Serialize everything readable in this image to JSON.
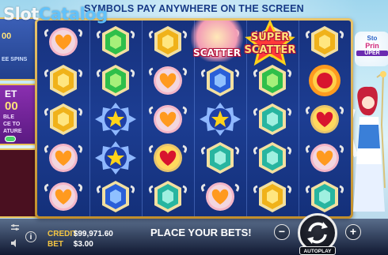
{
  "watermark": {
    "part1": "Slot",
    "part2": "Catalog"
  },
  "banner": {
    "text": "SYMBOLS PAY ANYWHERE ON THE SCREEN"
  },
  "left_panel": {
    "ante_amount": "00",
    "ante_sub": "EE SPINS",
    "bet_title": "ET",
    "bet_amount": "00",
    "bet_desc": "BLE\nCE TO\nATURE"
  },
  "right_panel": {
    "logo_line1": "Sto",
    "logo_line2": "Prin",
    "logo_line3": "UPER"
  },
  "grid": {
    "columns": 6,
    "rows": 5,
    "symbols": [
      [
        "heart-pink",
        "gem-green",
        "gem-yellow",
        "heart-pink",
        "gem-yellow",
        "gem-yellow"
      ],
      [
        "gem-yellow",
        "gem-green",
        "heart-pink",
        "gem-blue",
        "gem-green",
        "sun-red"
      ],
      [
        "gem-yellow",
        "star-blue",
        "heart-pink",
        "star-blue",
        "gem-teal",
        "heart-red"
      ],
      [
        "heart-pink",
        "star-blue",
        "heart-red",
        "gem-teal",
        "gem-teal",
        "heart-pink"
      ],
      [
        "heart-pink",
        "gem-blue",
        "gem-teal",
        "heart-pink",
        "gem-yellow",
        "gem-teal"
      ]
    ],
    "scatter_label": "SCATTER",
    "super_scatter_label_1": "SUPER",
    "super_scatter_label_2": "SCATTER"
  },
  "bottom": {
    "credit_label": "CREDIT",
    "credit_value": "$99,971.60",
    "bet_label": "BET",
    "bet_value": "$3.00",
    "message": "PLACE YOUR BETS!",
    "minus": "−",
    "plus": "+",
    "autoplay": "AUTOPLAY",
    "info": "i"
  },
  "colors": {
    "frame_gold": "#e8c46b",
    "reel_bg": "#1c3d92",
    "banner_text": "#173a86",
    "credit_label": "#f4c542"
  }
}
